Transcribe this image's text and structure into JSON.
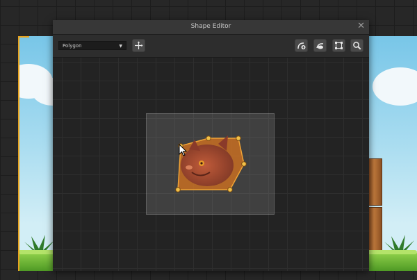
{
  "window": {
    "title": "Shape Editor",
    "close_glyph": "✕"
  },
  "toolbar": {
    "shape_type": "Polygon",
    "shape_type_options": [
      "Polygon"
    ],
    "buttons": [
      {
        "name": "origin-move-button",
        "icon": "crosshair-arrows-icon"
      },
      {
        "name": "add-point-button",
        "icon": "add-point-icon"
      },
      {
        "name": "remove-point-button",
        "icon": "remove-point-icon"
      },
      {
        "name": "fit-bounds-button",
        "icon": "bounds-icon"
      },
      {
        "name": "zoom-button",
        "icon": "magnifier-icon"
      }
    ]
  },
  "colors": {
    "polygon_fill": "#d9741e",
    "polygon_stroke": "#f0a336",
    "vertex_fill": "#f1c14a",
    "accent_border": "#e7a31f"
  },
  "cursor_icon": "arrow-cursor-icon"
}
